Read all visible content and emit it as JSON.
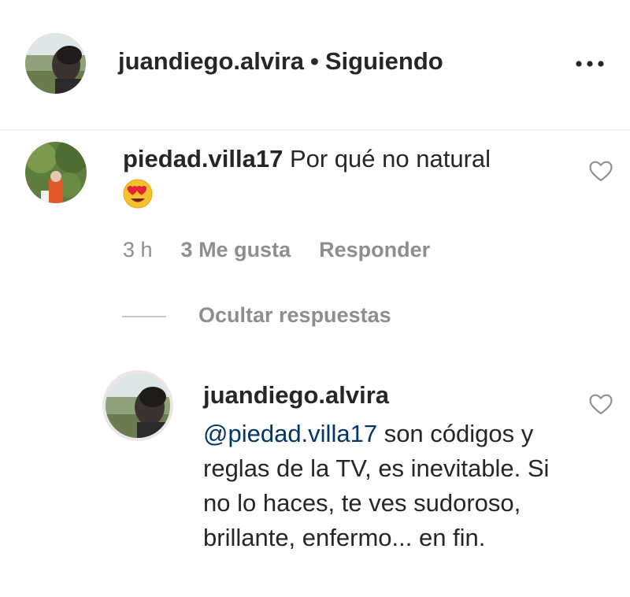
{
  "header": {
    "username": "juandiego.alvira",
    "separator": "•",
    "follow_status": "Siguiendo",
    "more_icon": "more-horizontal-icon"
  },
  "comment": {
    "username": "piedad.villa17",
    "text": "Por qué no natural",
    "emoji": "😍",
    "time": "3 h",
    "likes": "3 Me gusta",
    "reply_label": "Responder",
    "like_icon": "heart-outline-icon"
  },
  "replies_toggle": "Ocultar respuestas",
  "reply": {
    "username": "juandiego.alvira",
    "mention": "@piedad.villa17",
    "text": "son códigos y reglas de la TV, es inevitable. Si no lo haces, te ves sudoroso, brillante, enfermo... en fin.",
    "like_icon": "heart-outline-icon"
  },
  "colors": {
    "text": "#262626",
    "secondary": "#8e8e8e",
    "mention": "#003569",
    "divider": "#efefef"
  }
}
